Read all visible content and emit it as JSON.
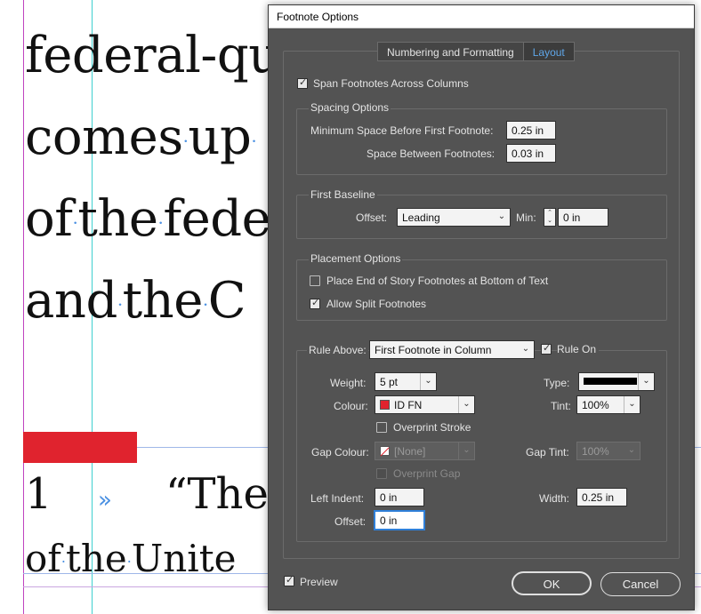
{
  "document": {
    "lines": [
      {
        "parts": [
          "federal-qu"
        ]
      },
      {
        "parts": [
          "comes",
          "up"
        ]
      },
      {
        "parts": [
          "of",
          "the",
          "fede"
        ]
      },
      {
        "parts": [
          "and",
          "the",
          "C"
        ]
      }
    ],
    "footnote_number": "1",
    "footnote_arrow": "»",
    "footnote_text": "“The",
    "footnote_line2": [
      "of",
      "the",
      "Unite"
    ]
  },
  "dialog": {
    "title": "Footnote Options",
    "tabs": [
      {
        "label": "Numbering and Formatting",
        "active": false
      },
      {
        "label": "Layout",
        "active": true
      }
    ],
    "span_footnotes": {
      "label": "Span Footnotes Across Columns",
      "checked": true
    },
    "spacing": {
      "heading": "Spacing Options",
      "min_space_label": "Minimum Space Before First Footnote:",
      "min_space_value": "0.25 in",
      "between_label": "Space Between Footnotes:",
      "between_value": "0.03 in"
    },
    "first_baseline": {
      "heading": "First Baseline",
      "offset_label": "Offset:",
      "offset_value": "Leading",
      "min_label": "Min:",
      "min_value": "0 in"
    },
    "placement": {
      "heading": "Placement Options",
      "end_of_story": {
        "label": "Place End of Story Footnotes at Bottom of Text",
        "checked": false
      },
      "allow_split": {
        "label": "Allow Split Footnotes",
        "checked": true
      }
    },
    "rule": {
      "rule_above_label": "Rule Above:",
      "rule_above_value": "First Footnote in Column",
      "rule_on": {
        "label": "Rule On",
        "checked": true
      },
      "weight_label": "Weight:",
      "weight_value": "5 pt",
      "type_label": "Type:",
      "colour_label": "Colour:",
      "colour_value": "ID FN",
      "tint_label": "Tint:",
      "tint_value": "100%",
      "overprint_stroke": {
        "label": "Overprint Stroke",
        "checked": false
      },
      "gap_colour_label": "Gap Colour:",
      "gap_colour_value": "[None]",
      "gap_tint_label": "Gap Tint:",
      "gap_tint_value": "100%",
      "overprint_gap": {
        "label": "Overprint Gap",
        "checked": false
      },
      "left_indent_label": "Left Indent:",
      "left_indent_value": "0 in",
      "width_label": "Width:",
      "width_value": "0.25 in",
      "offset_label": "Offset:",
      "offset_value": "0 in"
    },
    "preview": {
      "label": "Preview",
      "checked": true
    },
    "ok_label": "OK",
    "cancel_label": "Cancel"
  },
  "colors": {
    "dialog_bg": "#535353",
    "accent": "#5fa6e8",
    "rule_red": "#e0232e",
    "guide_magenta": "#c043c0",
    "guide_cyan": "#3fd0d0"
  }
}
